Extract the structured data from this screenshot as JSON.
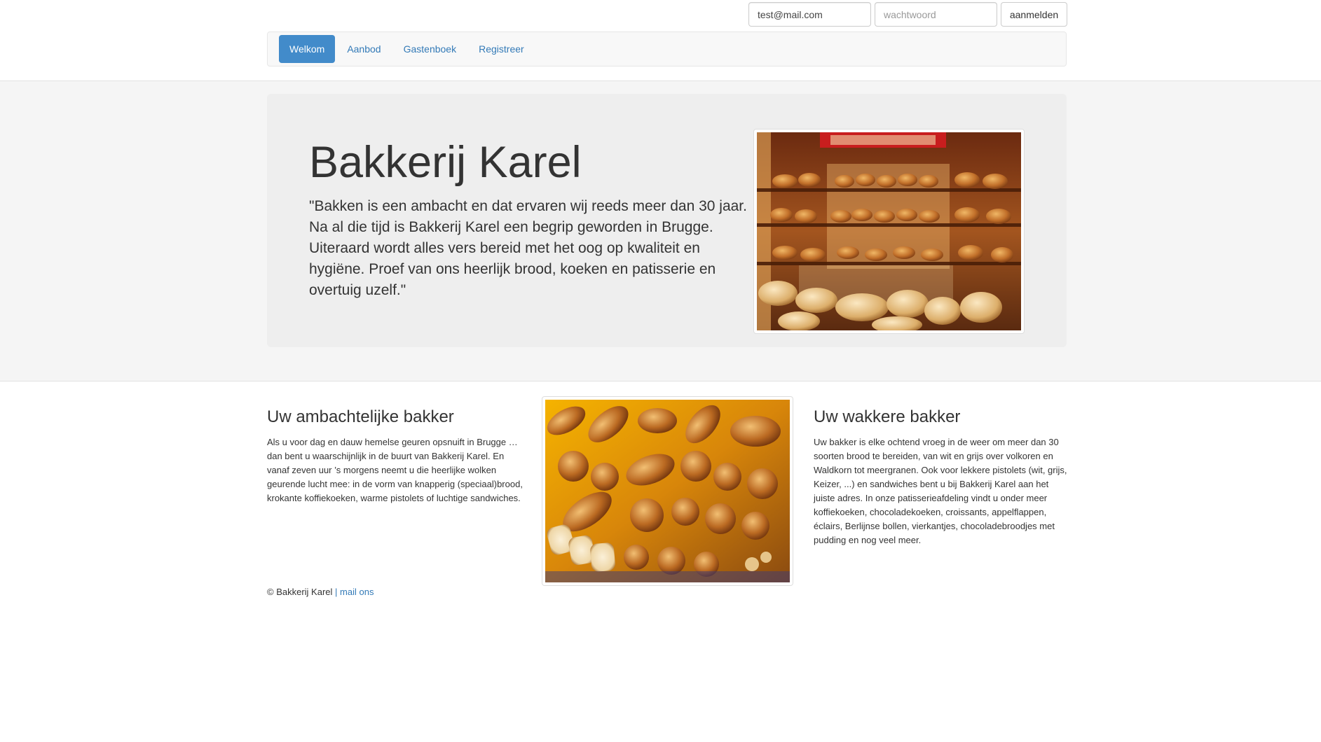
{
  "login": {
    "email_value": "test@mail.com",
    "password_placeholder": "wachtwoord",
    "submit_label": "aanmelden"
  },
  "nav": {
    "items": [
      {
        "label": "Welkom",
        "active": true
      },
      {
        "label": "Aanbod",
        "active": false
      },
      {
        "label": "Gastenboek",
        "active": false
      },
      {
        "label": "Registreer",
        "active": false
      }
    ]
  },
  "hero": {
    "title": "Bakkerij Karel",
    "quote": "\"Bakken is een ambacht en dat ervaren wij reeds meer dan 30 jaar. Na al die tijd is Bakkerij Karel een begrip geworden in Brugge. Uiteraard wordt alles vers bereid met het oog op kwaliteit en hygiëne. Proef van ons heerlijk brood, koeken en patisserie en overtuig uzelf.\""
  },
  "sections": {
    "left": {
      "title": "Uw ambachtelijke bakker",
      "text": "Als u voor dag en dauw hemelse geuren opsnuift in Brugge … dan bent u waarschijnlijk in de buurt van Bakkerij Karel. En vanaf zeven uur ’s morgens neemt u die heerlijke wolken geurende lucht mee: in de vorm van knapperig (speciaal)brood, krokante koffiekoeken, warme pistolets of luchtige sandwiches."
    },
    "right": {
      "title": "Uw wakkere bakker",
      "text": "Uw bakker is elke ochtend vroeg in de weer om meer dan 30 soorten brood te bereiden, van wit en grijs over volkoren en Waldkorn tot meergranen. Ook voor lekkere pistolets (wit, grijs, Keizer, ...) en sandwiches bent u bij Bakkerij Karel aan het juiste adres. In onze patisserieafdeling vindt u onder meer koffiekoeken, chocoladekoeken, croissants, appelflappen, éclairs, Berlijnse bollen, vierkantjes, chocoladebroodjes met pudding en nog veel meer."
    }
  },
  "footer": {
    "copyright": "© Bakkerij Karel",
    "separator": "|",
    "mail_link": "mail ons"
  },
  "colors": {
    "nav_active_bg": "#428bca",
    "link": "#337ab7",
    "jumbotron_bg": "#eeeeee",
    "band_bg": "#f5f5f5"
  }
}
